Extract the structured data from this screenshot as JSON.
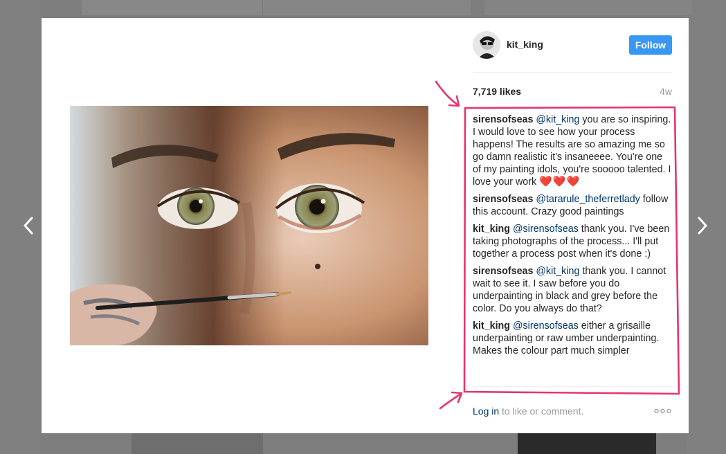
{
  "post": {
    "username": "kit_king",
    "follow_label": "Follow",
    "likes": "7,719 likes",
    "age": "4w"
  },
  "comments": [
    {
      "author": "sirensofseas",
      "mention": "@kit_king",
      "text": " you are so inspiring. I would love to see how your process happens! The results are so amazing me so go damn realistic it's insaneeee. You're one of my painting idols, you're sooooo talented. I love your work ",
      "emoji": "❤️❤️❤️"
    },
    {
      "author": "sirensofseas",
      "mention": "@tararule_theferretlady",
      "text": " follow this account. Crazy good paintings",
      "emoji": ""
    },
    {
      "author": "kit_king",
      "mention": "@sirensofseas",
      "text": " thank you. I've been taking photographs of the process... I'll put together a process post when it's done :)",
      "emoji": ""
    },
    {
      "author": "sirensofseas",
      "mention": "@kit_king",
      "text": " thank you. I cannot wait to see it. I saw before you do underpainting in black and grey before the color. Do you always do that?",
      "emoji": ""
    },
    {
      "author": "kit_king",
      "mention": "@sirensofseas",
      "text": " either a grisaille underpainting or raw umber underpainting. Makes the colour part much simpler",
      "emoji": ""
    }
  ],
  "footer": {
    "login_link": "Log in",
    "login_rest": " to like or comment."
  },
  "icons": {
    "prev": "chevron-left-icon",
    "next": "chevron-right-icon",
    "media_next": "chevron-right-circle-icon",
    "more": "more-horizontal-icon"
  },
  "colors": {
    "follow_button": "#3897f0",
    "mention": "#003569",
    "annotation": "#e8336d",
    "backdrop": "#7d7d7d"
  }
}
